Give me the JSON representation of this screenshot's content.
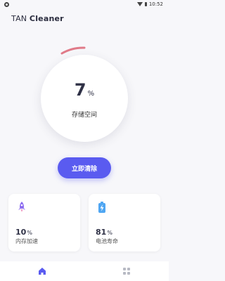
{
  "status_bar": {
    "time": "10:52"
  },
  "app": {
    "title_prefix": "TAN",
    "title_suffix": "Cleaner"
  },
  "storage": {
    "value": "7",
    "unit": "%",
    "label": "存储空间",
    "percent": 7
  },
  "actions": {
    "clean_label": "立即清除"
  },
  "cards": {
    "memory": {
      "value": "10",
      "unit": "%",
      "label": "内存加速",
      "icon": "rocket-icon"
    },
    "battery": {
      "value": "81",
      "unit": "%",
      "label": "电池寿命",
      "icon": "battery-charging-icon"
    }
  },
  "nav": {
    "items": [
      {
        "icon": "home-icon",
        "active": true
      },
      {
        "icon": "apps-grid-icon",
        "active": false
      }
    ]
  },
  "colors": {
    "accent": "#5a5bf0",
    "ring": "#e07a88",
    "background": "#f7f7fa"
  }
}
